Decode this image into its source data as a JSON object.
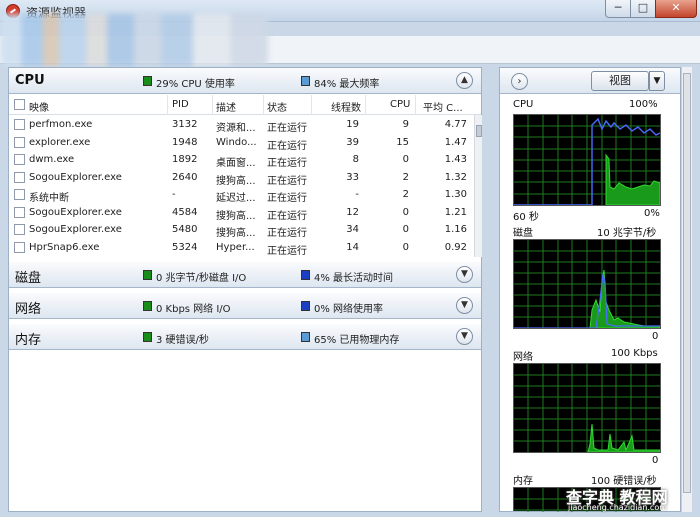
{
  "window": {
    "title": "资源监视器",
    "controls": {
      "minimize": "─",
      "maximize": "□",
      "close": "✕"
    },
    "icon": "resource-monitor-icon"
  },
  "cpu": {
    "title": "CPU",
    "legend1": "29% CPU 使用率",
    "legend2": "84% 最大频率",
    "collapse_icon": "chevron-up-icon",
    "columns": [
      "映像",
      "PID",
      "描述",
      "状态",
      "线程数",
      "CPU",
      "平均 C..."
    ],
    "rows": [
      {
        "image": "perfmon.exe",
        "pid": "3132",
        "desc": "资源和...",
        "status": "正在运行",
        "threads": "19",
        "cpu": "9",
        "avg": "4.77"
      },
      {
        "image": "explorer.exe",
        "pid": "1948",
        "desc": "Windo...",
        "status": "正在运行",
        "threads": "39",
        "cpu": "15",
        "avg": "1.47"
      },
      {
        "image": "dwm.exe",
        "pid": "1892",
        "desc": "桌面窗...",
        "status": "正在运行",
        "threads": "8",
        "cpu": "0",
        "avg": "1.43"
      },
      {
        "image": "SogouExplorer.exe",
        "pid": "2640",
        "desc": "搜狗高...",
        "status": "正在运行",
        "threads": "33",
        "cpu": "2",
        "avg": "1.32"
      },
      {
        "image": "系统中断",
        "pid": "-",
        "desc": "延迟过...",
        "status": "正在运行",
        "threads": "-",
        "cpu": "2",
        "avg": "1.30"
      },
      {
        "image": "SogouExplorer.exe",
        "pid": "4584",
        "desc": "搜狗高...",
        "status": "正在运行",
        "threads": "12",
        "cpu": "0",
        "avg": "1.21"
      },
      {
        "image": "SogouExplorer.exe",
        "pid": "5480",
        "desc": "搜狗高...",
        "status": "正在运行",
        "threads": "34",
        "cpu": "0",
        "avg": "1.16"
      },
      {
        "image": "HprSnap6.exe",
        "pid": "5324",
        "desc": "Hyper...",
        "status": "正在运行",
        "threads": "14",
        "cpu": "0",
        "avg": "0.92"
      }
    ]
  },
  "disk": {
    "title": "磁盘",
    "legend1": "0 兆字节/秒磁盘 I/O",
    "legend2": "4% 最长活动时间"
  },
  "network": {
    "title": "网络",
    "legend1": "0 Kbps 网络 I/O",
    "legend2": "0% 网络使用率"
  },
  "memory": {
    "title": "内存",
    "legend1": "3 硬错误/秒",
    "legend2": "65% 已用物理内存"
  },
  "right": {
    "view_label": "视图",
    "graphs": {
      "cpu": {
        "label": "CPU",
        "max": "100%",
        "time": "60 秒",
        "min": "0%"
      },
      "disk": {
        "label": "磁盘",
        "max": "10 兆字节/秒",
        "min": "0"
      },
      "network": {
        "label": "网络",
        "max": "100 Kbps",
        "min": "0"
      },
      "memory": {
        "label": "内存",
        "max": "100 硬错误/秒"
      }
    }
  },
  "watermark": {
    "main": "查字典 教程网",
    "sub": "jiaocheng.chazidian.com"
  },
  "colors": {
    "graph_bg": "#000000",
    "grid": "#1f7a1f",
    "series_green": "#27c427",
    "series_blue": "#5a78ff"
  }
}
